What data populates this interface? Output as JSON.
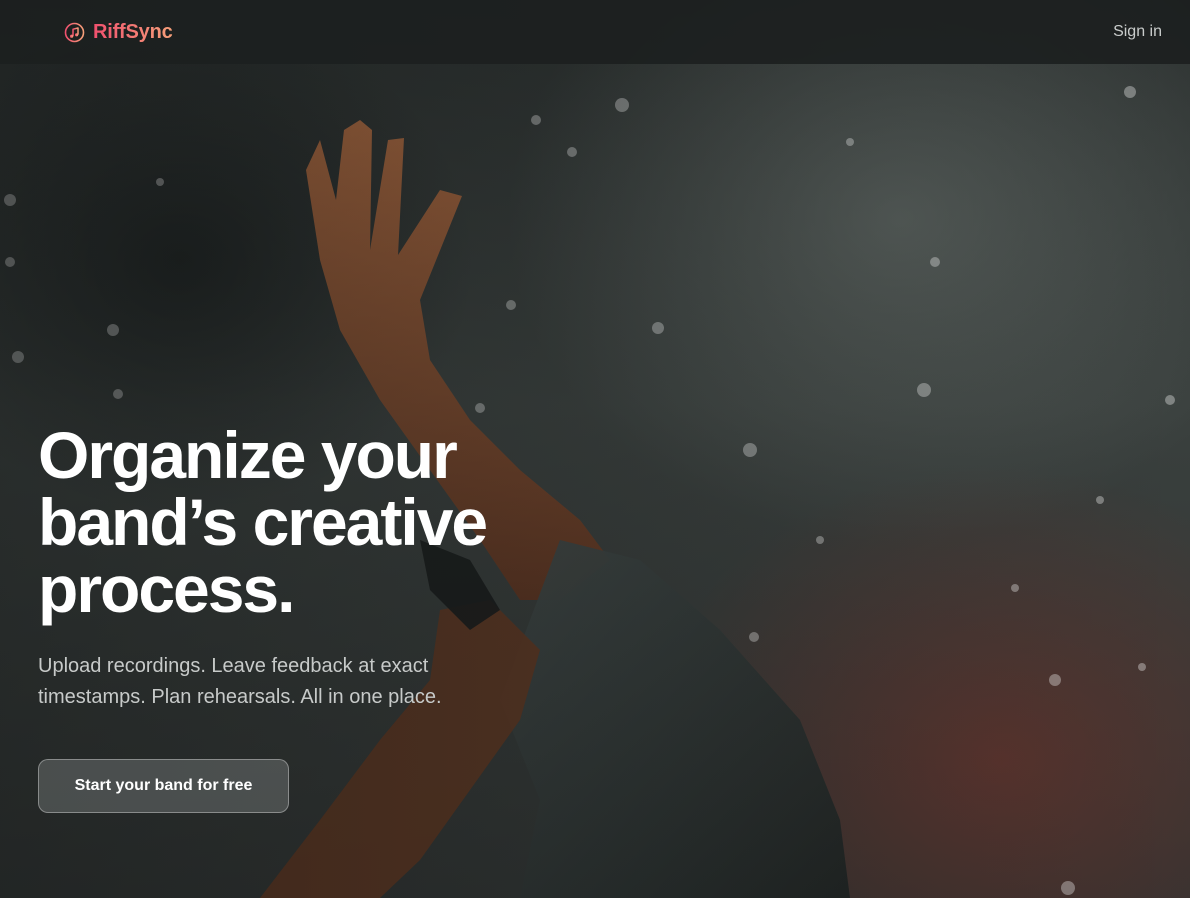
{
  "nav": {
    "brand_name": "RiffSync",
    "brand_icon": "music-note-icon",
    "signin_label": "Sign in"
  },
  "hero": {
    "headline_line1": "Organize your",
    "headline_line2": "band’s creative",
    "headline_line3": "process.",
    "subheadline": "Upload recordings. Leave feedback at exact timestamps. Plan rehearsals. All in one place.",
    "cta_label": "Start your band for free",
    "background_image": "concert-raised-hand-photo"
  },
  "colors": {
    "brand_gradient_start": "#f0506e",
    "brand_gradient_end": "#f6a07a",
    "navbar_bg": "#1c1f1f",
    "headline": "#ffffff",
    "subheadline": "#c7cac9"
  }
}
